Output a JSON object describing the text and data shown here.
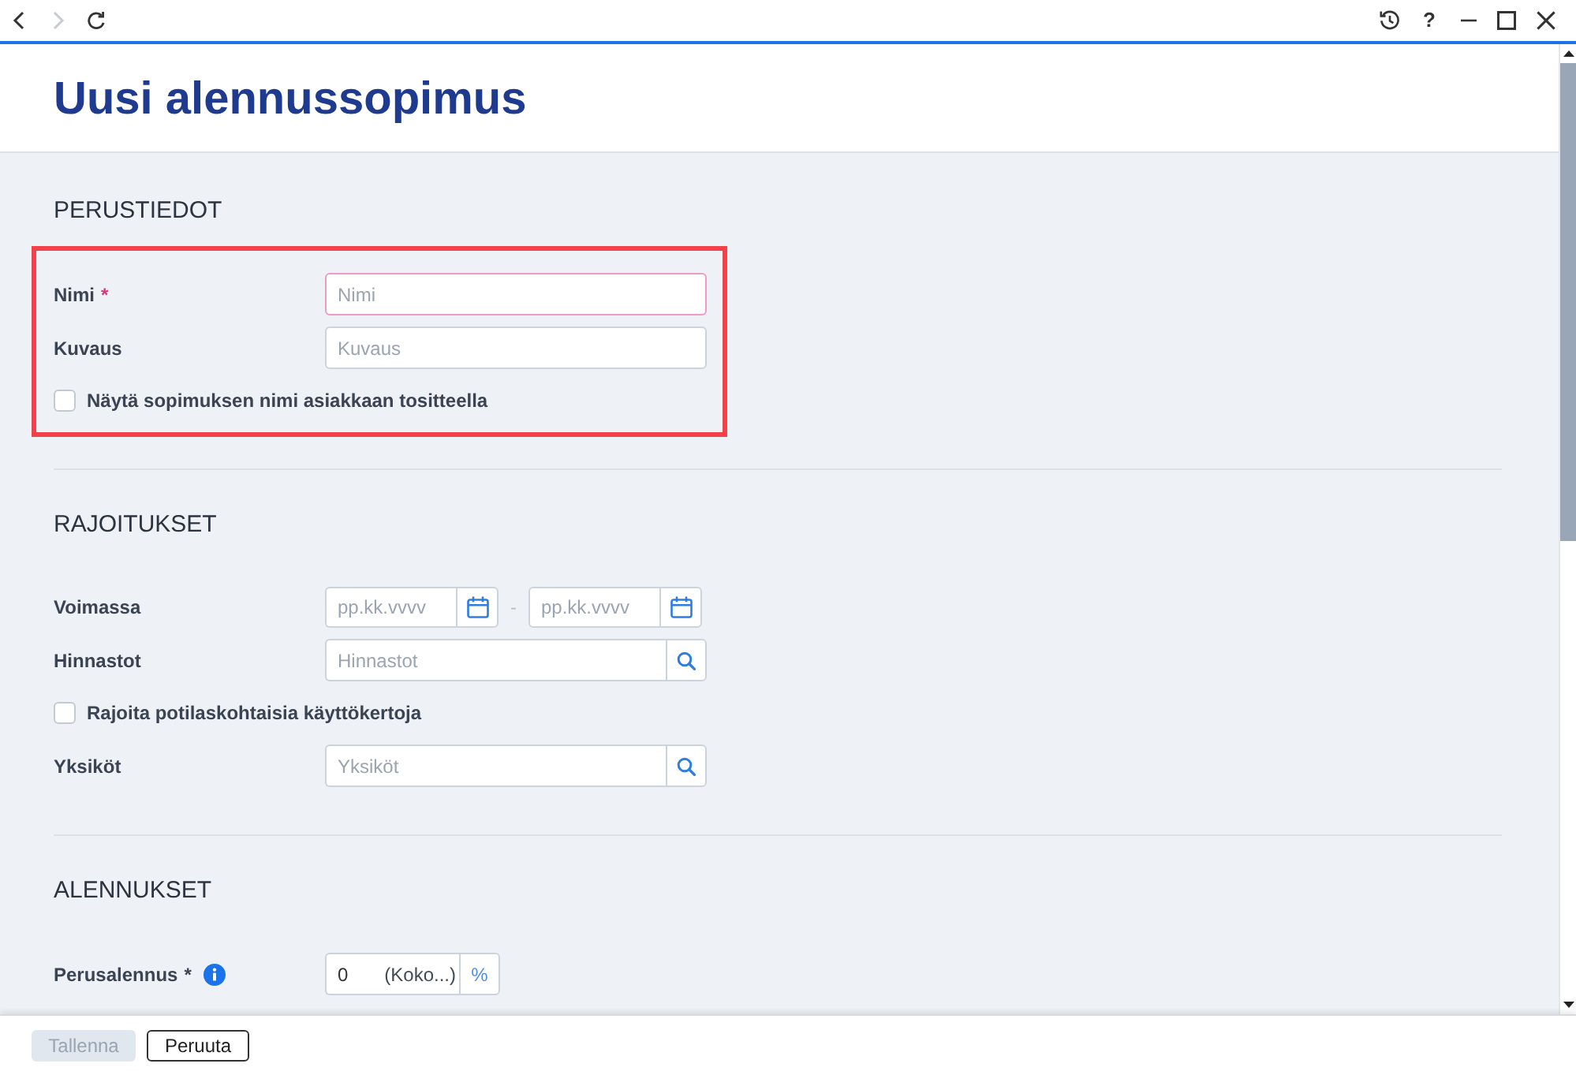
{
  "toolbar": {
    "nav_buttons": [
      {
        "kind": "back",
        "disabled": false
      },
      {
        "kind": "forward",
        "disabled": true
      },
      {
        "kind": "reload",
        "disabled": false
      }
    ],
    "window_buttons": [
      {
        "kind": "history"
      },
      {
        "kind": "help",
        "label": "?"
      },
      {
        "kind": "minimize"
      },
      {
        "kind": "maximize"
      },
      {
        "kind": "close"
      }
    ]
  },
  "title": "Uusi alennussopimus",
  "sections": [
    {
      "heading": "PERUSTIEDOT",
      "highlighted": true,
      "fields": [
        {
          "kind": "text",
          "label": "Nimi",
          "required_mark": "*",
          "invalid": true,
          "placeholder": "Nimi"
        },
        {
          "kind": "text",
          "label": "Kuvaus",
          "invalid": false,
          "placeholder": "Kuvaus"
        },
        {
          "kind": "checkbox",
          "label": "Näytä sopimuksen nimi asiakkaan tositteella",
          "checked": false
        }
      ]
    },
    {
      "heading": "RAJOITUKSET",
      "highlighted": false,
      "fields": [
        {
          "kind": "date_range",
          "label": "Voimassa",
          "start_placeholder": "pp.kk.vvvv",
          "separator": "-",
          "end_placeholder": "pp.kk.vvvv"
        },
        {
          "kind": "search",
          "label": "Hinnastot",
          "placeholder": "Hinnastot"
        },
        {
          "kind": "checkbox",
          "label": "Rajoita potilaskohtaisia käyttökertoja",
          "checked": false
        },
        {
          "kind": "search",
          "label": "Yksiköt",
          "placeholder": "Yksiköt"
        }
      ]
    },
    {
      "heading": "ALENNUKSET",
      "highlighted": false,
      "fields": [
        {
          "kind": "percent",
          "label": "Perusalennus",
          "required_mark": "*",
          "invalid": false,
          "info": true,
          "value": "0",
          "suffix": "(Koko...)",
          "unit": "%"
        }
      ]
    }
  ],
  "footer": {
    "buttons": [
      {
        "kind": "save",
        "label": "Tallenna",
        "disabled": true
      },
      {
        "kind": "cancel",
        "label": "Peruuta",
        "disabled": false
      }
    ]
  }
}
